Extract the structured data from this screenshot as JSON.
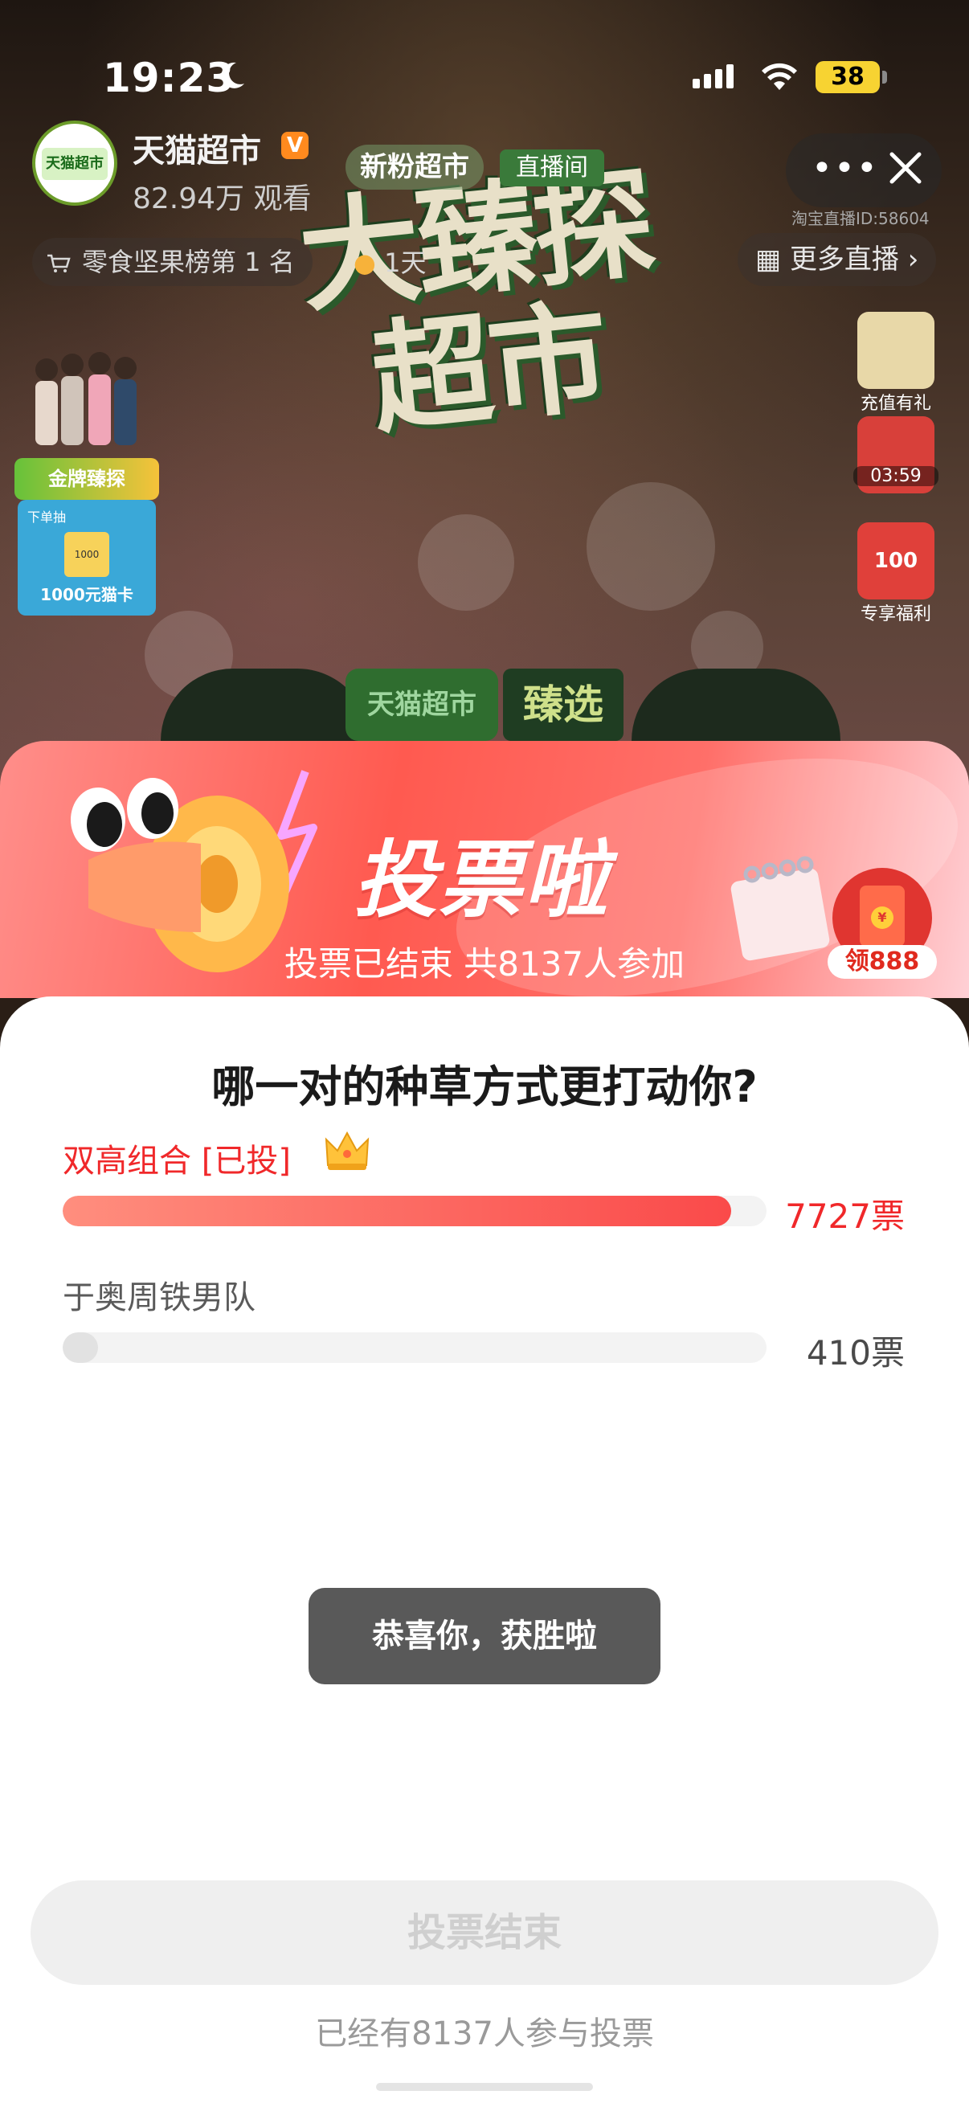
{
  "status_bar": {
    "time": "19:23",
    "battery": "38"
  },
  "live_room": {
    "store_name": "天猫超市",
    "verified_badge": "V",
    "viewers": "82.94万 观看",
    "new_fans": "新粉超市",
    "live_room_tag": "直播间",
    "streamer_id": "淘宝直播ID:58604",
    "rank_text": "零食坚果榜第 1 名",
    "hot_days": "1天",
    "more_live": "更多直播 ›",
    "avatar_text": "天猫超市",
    "stage_title_line1": "大臻探",
    "stage_title_line2": "超市",
    "stage_sign_left": "天猫超市",
    "stage_sign_right": "臻选",
    "promo": {
      "banner": "金牌臻探",
      "card_top": "下单抽",
      "card_img": "1000",
      "card_label": "1000元猫卡"
    },
    "side_items": [
      {
        "label": "充值有礼"
      },
      {
        "label": "03:59"
      },
      {
        "label": "专享福利",
        "badge": "100"
      }
    ]
  },
  "vote": {
    "heading": "投票啦",
    "summary": "投票已结束 共8137人参加",
    "redpack_label": "领888",
    "question": "哪一对的种草方式更打动你?",
    "options": [
      {
        "label": "双高组合 [已投]",
        "votes": "7727票",
        "share": 0.95
      },
      {
        "label": "于奥周铁男队",
        "votes": "410票",
        "share": 0.05
      }
    ],
    "toast": "恭喜你，获胜啦",
    "end_button": "投票结束",
    "footer_note": "已经有8137人参与投票"
  },
  "colors": {
    "accent_red": "#f0282a",
    "sheet_gradient_start": "#ff8e8a",
    "sheet_gradient_end": "#ff5a50"
  }
}
